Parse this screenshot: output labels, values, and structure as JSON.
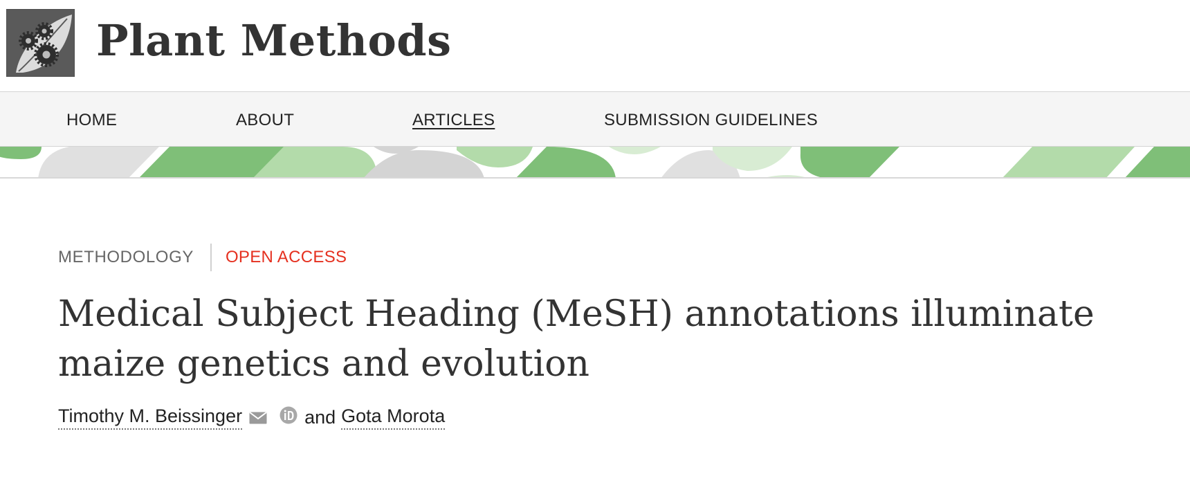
{
  "header": {
    "logo_icon": "gears-leaf-logo-icon",
    "site_title": "Plant Methods"
  },
  "nav": {
    "items": [
      {
        "label": "HOME"
      },
      {
        "label": "ABOUT"
      },
      {
        "label": "ARTICLES",
        "active": true
      },
      {
        "label": "SUBMISSION GUIDELINES"
      }
    ]
  },
  "colors": {
    "accent_red": "#e5301f",
    "banner_green": "#7fbf78",
    "banner_light_green": "#b3dbaa",
    "banner_grey": "#d4d4d4"
  },
  "article": {
    "type": "METHODOLOGY",
    "access": "OPEN ACCESS",
    "title": "Medical Subject Heading (MeSH) annotations illuminate maize genetics and evolution",
    "authors": [
      {
        "name": "Timothy M. Beissinger",
        "icons": [
          "mail-icon",
          "orcid-icon"
        ]
      },
      {
        "name": "Gota Morota"
      }
    ],
    "authors_conjunction": "and"
  }
}
